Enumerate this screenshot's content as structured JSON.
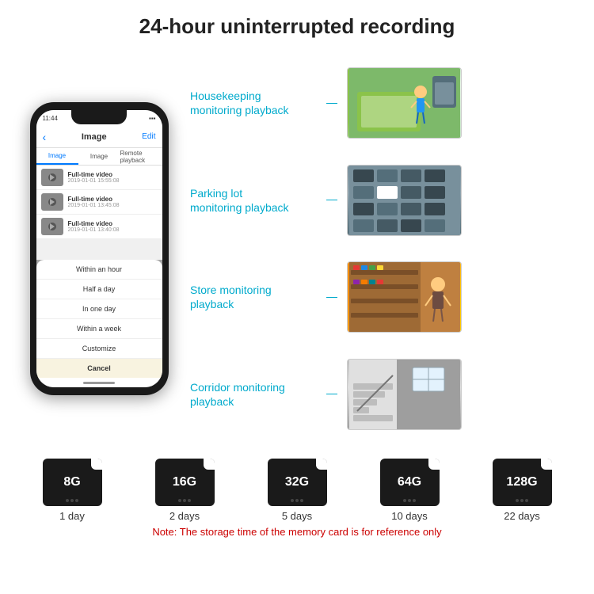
{
  "header": {
    "title": "24-hour uninterrupted recording"
  },
  "phone": {
    "status_time": "11:44",
    "nav_title": "Image",
    "nav_edit": "Edit",
    "tabs": [
      "Image",
      "Image",
      "Remote playback"
    ],
    "videos": [
      {
        "name": "Full-time video",
        "date": "2019-01-01 15:55:08"
      },
      {
        "name": "Full-time video",
        "date": "2019-01-01 13:45:08"
      },
      {
        "name": "Full-time video",
        "date": "2019-01-01 13:40:08"
      }
    ],
    "dropdown_items": [
      "Within an hour",
      "Half a day",
      "In one day",
      "Within a week",
      "Customize"
    ],
    "dropdown_cancel": "Cancel"
  },
  "monitoring": [
    {
      "label": "Housekeeping monitoring playback",
      "photo_class": "photo-housekeeping"
    },
    {
      "label": "Parking lot monitoring playback",
      "photo_class": "photo-parking"
    },
    {
      "label": "Store monitoring playback",
      "photo_class": "photo-store"
    },
    {
      "label": "Corridor monitoring playback",
      "photo_class": "photo-corridor"
    }
  ],
  "memory_cards": [
    {
      "size": "8G",
      "days": "1 day"
    },
    {
      "size": "16G",
      "days": "2 days"
    },
    {
      "size": "32G",
      "days": "5 days"
    },
    {
      "size": "64G",
      "days": "10 days"
    },
    {
      "size": "128G",
      "days": "22 days"
    }
  ],
  "note": "Note: The storage time of the memory card is for reference only"
}
